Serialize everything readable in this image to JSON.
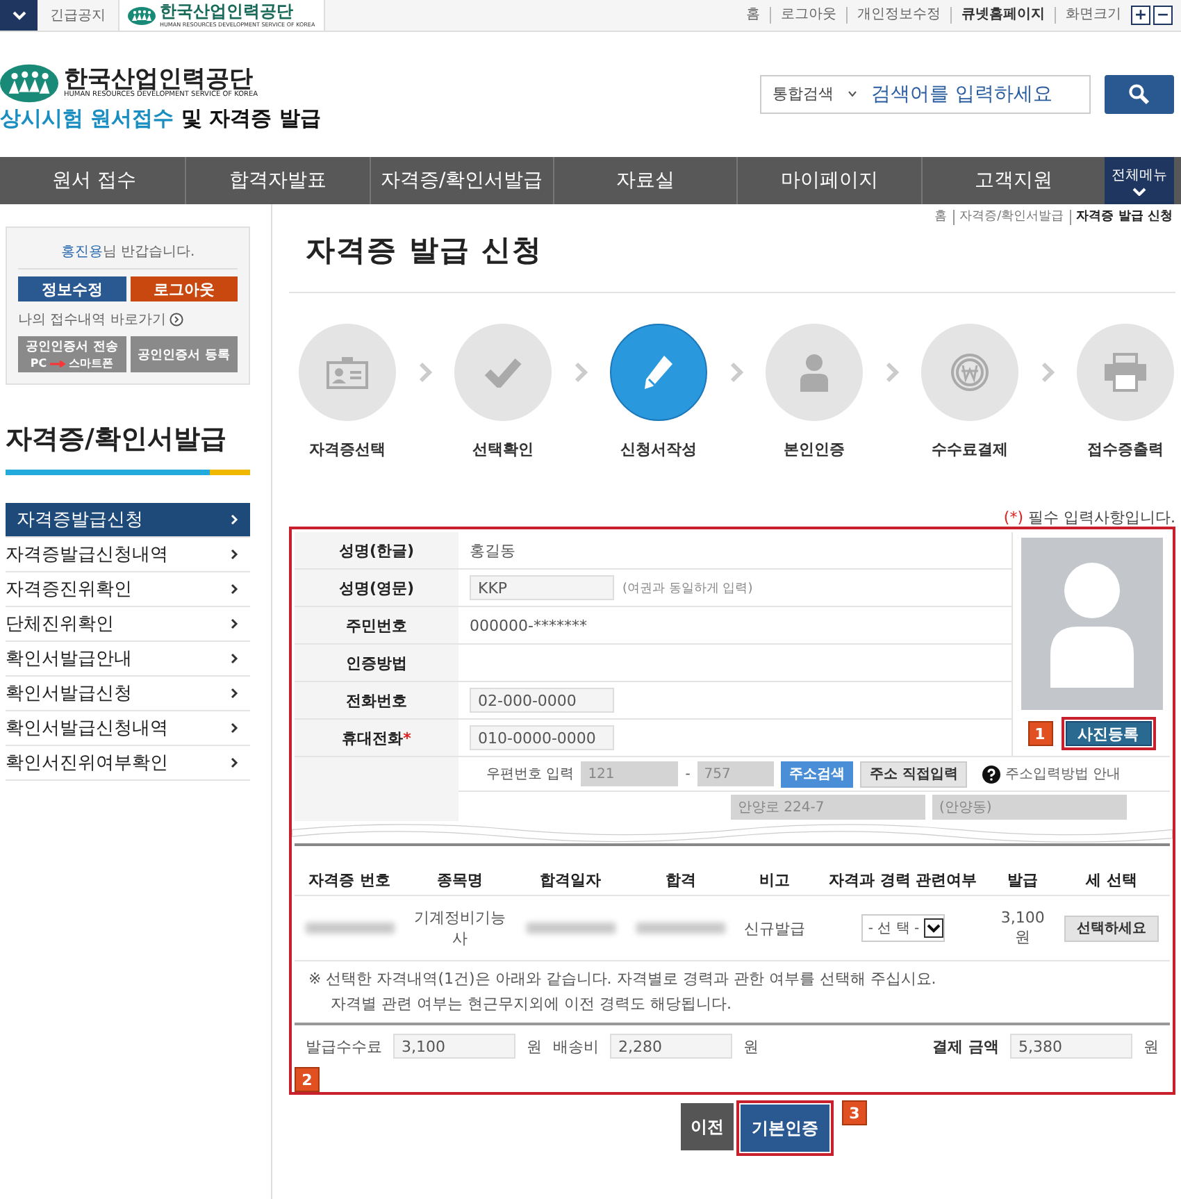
{
  "top_bar": {
    "notice": "긴급공지",
    "logo": "한국산업인력공단",
    "logo_sub": "HUMAN RESOURCES DEVELOPMENT SERVICE OF KOREA",
    "links": [
      {
        "label": "홈",
        "bold": false
      },
      {
        "label": "로그아웃",
        "bold": false
      },
      {
        "label": "개인정보수정",
        "bold": false
      },
      {
        "label": "큐넷홈페이지",
        "bold": true
      },
      {
        "label": "화면크기",
        "bold": false
      }
    ],
    "zoom_in": "+",
    "zoom_out": "−"
  },
  "header": {
    "logo": "한국산업인력공단",
    "logo_sub": "HUMAN RESOURCES DEVELOPMENT SERVICE OF KOREA",
    "title_highlight": "상시시험 원서접수",
    "title_rest": "및 자격증 발급",
    "search": {
      "scope": "통합검색",
      "placeholder": "검색어를 입력하세요"
    }
  },
  "nav": {
    "items": [
      "원서 접수",
      "합격자발표",
      "자격증/확인서발급",
      "자료실",
      "마이페이지",
      "고객지원"
    ],
    "all_menu": "전체메뉴"
  },
  "sidebar": {
    "user_name": "홍진용",
    "greeting": "님 반갑습니다.",
    "edit_button": "정보수정",
    "logout_button": "로그아웃",
    "my_link": "나의 접수내역 바로가기",
    "cert_send": "공인인증서 전송",
    "cert_from": "PC",
    "cert_to": "스마트폰",
    "cert_register": "공인인증서 등록",
    "title": "자격증/확인서발급",
    "items": [
      {
        "label": "자격증발급신청",
        "selected": true
      },
      {
        "label": "자격증발급신청내역",
        "selected": false
      },
      {
        "label": "자격증진위확인",
        "selected": false
      },
      {
        "label": "단체진위확인",
        "selected": false
      },
      {
        "label": "확인서발급안내",
        "selected": false
      },
      {
        "label": "확인서발급신청",
        "selected": false
      },
      {
        "label": "확인서발급신청내역",
        "selected": false
      },
      {
        "label": "확인서진위여부확인",
        "selected": false
      }
    ]
  },
  "breadcrumb": [
    {
      "label": "홈",
      "current": false
    },
    {
      "label": "자격증/확인서발급",
      "current": false
    },
    {
      "label": "자격증 발급 신청",
      "current": true
    }
  ],
  "page_title": "자격증 발급 신청",
  "steps": [
    {
      "label": "자격증선택",
      "selected": false
    },
    {
      "label": "선택확인",
      "selected": false
    },
    {
      "label": "신청서작성",
      "selected": true
    },
    {
      "label": "본인인증",
      "selected": false
    },
    {
      "label": "수수료결제",
      "selected": false
    },
    {
      "label": "접수증출력",
      "selected": false
    }
  ],
  "required_note": {
    "mark": "(*)",
    "text": "필수 입력사항입니다."
  },
  "form": {
    "rows": [
      {
        "label": "성명(한글)",
        "kind": "text",
        "value": "홍길동"
      },
      {
        "label": "성명(영문)",
        "kind": "input",
        "value": "KKP",
        "hint": "(여권과 동일하게 입력)"
      },
      {
        "label": "주민번호",
        "kind": "text",
        "value": "000000-*******"
      },
      {
        "label": "인증방법",
        "kind": "text"
      },
      {
        "label": "전화번호",
        "kind": "input",
        "value": "02-000-0000"
      },
      {
        "label": "휴대전화",
        "kind": "input",
        "value": "010-0000-0000",
        "mark": "*"
      }
    ],
    "photo_badge": "1",
    "photo_button": "사진등록",
    "address": {
      "zip_label": "우편번호 입력",
      "zip1": "121",
      "zip_sep": "-",
      "zip2": "757",
      "search_button": "주소검색",
      "manual_button": "주소 직접입력",
      "help": "주소입력방법 안내",
      "line1": "안양로 224-7",
      "line2": "(안양동)"
    }
  },
  "table": {
    "columns": [
      "자격증 번호",
      "종목명",
      "합격일자",
      "합격",
      "비고",
      "자격과 경력 관련여부",
      "발급",
      "세 선택"
    ],
    "rows": [
      {
        "cells": [
          {
            "kind": "blurred"
          },
          {
            "kind": "text",
            "text": "기계정비기능사"
          },
          {
            "kind": "blurred"
          },
          {
            "kind": "blurred"
          },
          {
            "kind": "text",
            "text": "신규발급"
          },
          {
            "kind": "select",
            "text": "- 선 택 -"
          },
          {
            "kind": "text",
            "text": "3,100 원"
          },
          {
            "kind": "button",
            "text": "선택하세요"
          }
        ]
      }
    ]
  },
  "notes": [
    "※ 선택한 자격내역(1건)은 아래와 같습니다. 자격별로 경력과 관한 여부를 선택해 주십시요.",
    "자격별 관련 여부는 현근무지외에 이전 경력도 해당됩니다."
  ],
  "fees": [
    {
      "label": "발급수수료",
      "value": "3,100",
      "unit": "원"
    },
    {
      "label": "배송비",
      "value": "2,280",
      "unit": "원"
    },
    {
      "label": "결제 금액",
      "value": "5,380",
      "unit": "원"
    }
  ],
  "form_badge": "2",
  "buttons": {
    "prev": "이전",
    "next": "기본인증",
    "next_badge": "3"
  }
}
